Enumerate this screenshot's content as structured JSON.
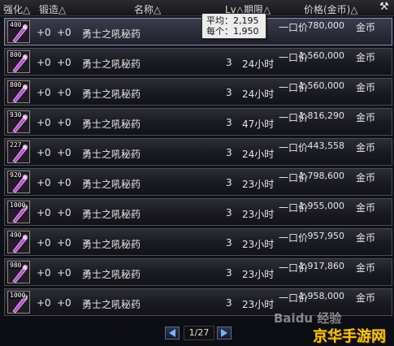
{
  "header": {
    "strengthen": "强化△",
    "forge": "锻造△",
    "name": "名称△",
    "lv_period": "Lv△期限△",
    "price": "价格(金币)△",
    "tool_icon": "hammer-icon"
  },
  "tooltip": {
    "avg": "平均：2,195",
    "each": "每个：1,950"
  },
  "rows": [
    {
      "count": "400",
      "str": "+0",
      "forge": "+0",
      "name": "勇士之吼秘药",
      "lv": "",
      "duration": "",
      "buy": "一口价",
      "price": "780,000",
      "currency": "金币"
    },
    {
      "count": "800",
      "str": "+0",
      "forge": "+0",
      "name": "勇士之吼秘药",
      "lv": "3",
      "duration": "24小时",
      "buy": "一口价",
      "price": "1,560,000",
      "currency": "金币"
    },
    {
      "count": "800",
      "str": "+0",
      "forge": "+0",
      "name": "勇士之吼秘药",
      "lv": "3",
      "duration": "24小时",
      "buy": "一口价",
      "price": "1,560,000",
      "currency": "金币"
    },
    {
      "count": "930",
      "str": "+0",
      "forge": "+0",
      "name": "勇士之吼秘药",
      "lv": "3",
      "duration": "47小时",
      "buy": "一口价",
      "price": "1,816,290",
      "currency": "金币"
    },
    {
      "count": "227",
      "str": "+0",
      "forge": "+0",
      "name": "勇士之吼秘药",
      "lv": "3",
      "duration": "24小时",
      "buy": "一口价",
      "price": "443,558",
      "currency": "金币"
    },
    {
      "count": "920",
      "str": "+0",
      "forge": "+0",
      "name": "勇士之吼秘药",
      "lv": "3",
      "duration": "23小时",
      "buy": "一口价",
      "price": "1,798,600",
      "currency": "金币"
    },
    {
      "count": "1000",
      "str": "+0",
      "forge": "+0",
      "name": "勇士之吼秘药",
      "lv": "3",
      "duration": "23小时",
      "buy": "一口价",
      "price": "1,955,000",
      "currency": "金币"
    },
    {
      "count": "490",
      "str": "+0",
      "forge": "+0",
      "name": "勇士之吼秘药",
      "lv": "3",
      "duration": "23小时",
      "buy": "一口价",
      "price": "957,950",
      "currency": "金币"
    },
    {
      "count": "980",
      "str": "+0",
      "forge": "+0",
      "name": "勇士之吼秘药",
      "lv": "3",
      "duration": "23小时",
      "buy": "一口价",
      "price": "1,917,860",
      "currency": "金币"
    },
    {
      "count": "1000",
      "str": "+0",
      "forge": "+0",
      "name": "勇士之吼秘药",
      "lv": "3",
      "duration": "23小时",
      "buy": "一口价",
      "price": "1,958,000",
      "currency": "金币"
    }
  ],
  "pager": {
    "page": "1/27",
    "prev_icon": "triangle-left-icon",
    "next_icon": "triangle-right-icon"
  },
  "watermarks": {
    "baidu": "Baidu 经验",
    "site": "京华手游网"
  },
  "colors": {
    "tooltip_bg": "#ececec",
    "row_border": "#4a4b58",
    "selected_border": "#8a8fb8",
    "watermark_site": "#f3c31c"
  }
}
